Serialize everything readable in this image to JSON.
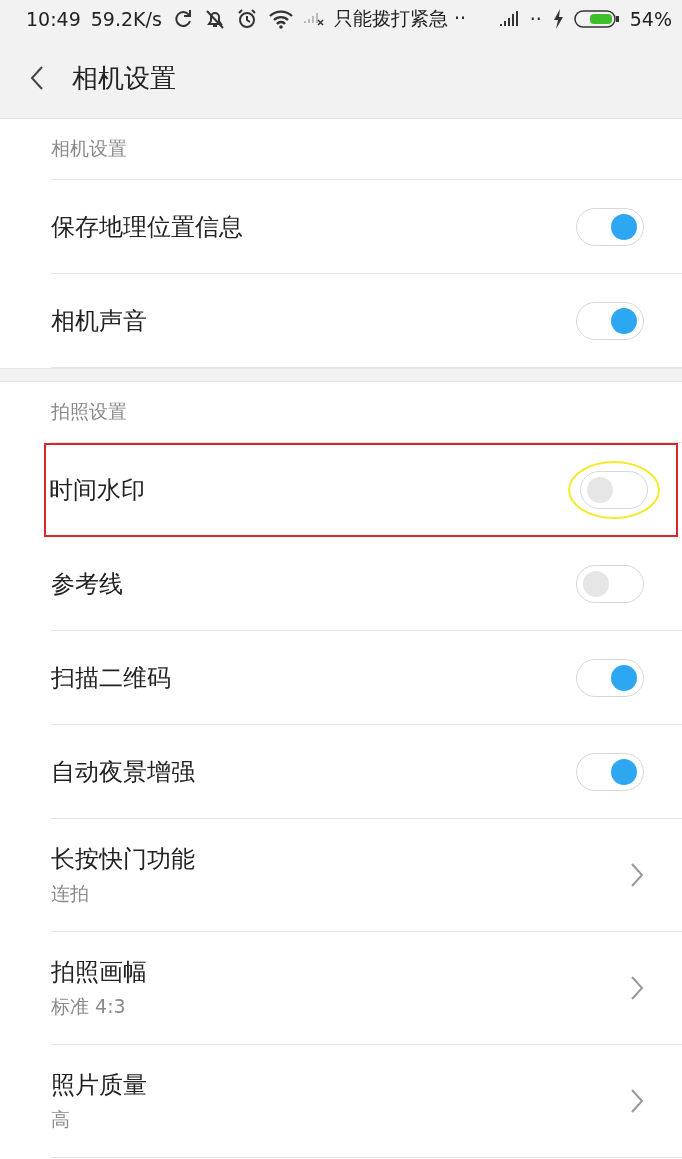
{
  "status_bar": {
    "time": "10:49",
    "speed": "59.2K/s",
    "carrier": "只能拨打紧急 ··",
    "dots": "··",
    "battery": "54%"
  },
  "header": {
    "title": "相机设置"
  },
  "sections": [
    {
      "title": "相机设置",
      "items": [
        {
          "kind": "toggle",
          "label": "保存地理位置信息",
          "on": true,
          "highlighted": false,
          "circled": false
        },
        {
          "kind": "toggle",
          "label": "相机声音",
          "on": true,
          "highlighted": false,
          "circled": false
        }
      ]
    },
    {
      "title": "拍照设置",
      "items": [
        {
          "kind": "toggle",
          "label": "时间水印",
          "on": false,
          "highlighted": true,
          "circled": true
        },
        {
          "kind": "toggle",
          "label": "参考线",
          "on": false,
          "highlighted": false,
          "circled": false
        },
        {
          "kind": "toggle",
          "label": "扫描二维码",
          "on": true,
          "highlighted": false,
          "circled": false
        },
        {
          "kind": "toggle",
          "label": "自动夜景增强",
          "on": true,
          "highlighted": false,
          "circled": false
        },
        {
          "kind": "link",
          "label": "长按快门功能",
          "value": "连拍",
          "highlighted": false
        },
        {
          "kind": "link",
          "label": "拍照画幅",
          "value": "标准 4:3",
          "highlighted": false
        },
        {
          "kind": "link",
          "label": "照片质量",
          "value": "高",
          "highlighted": false
        }
      ]
    }
  ]
}
